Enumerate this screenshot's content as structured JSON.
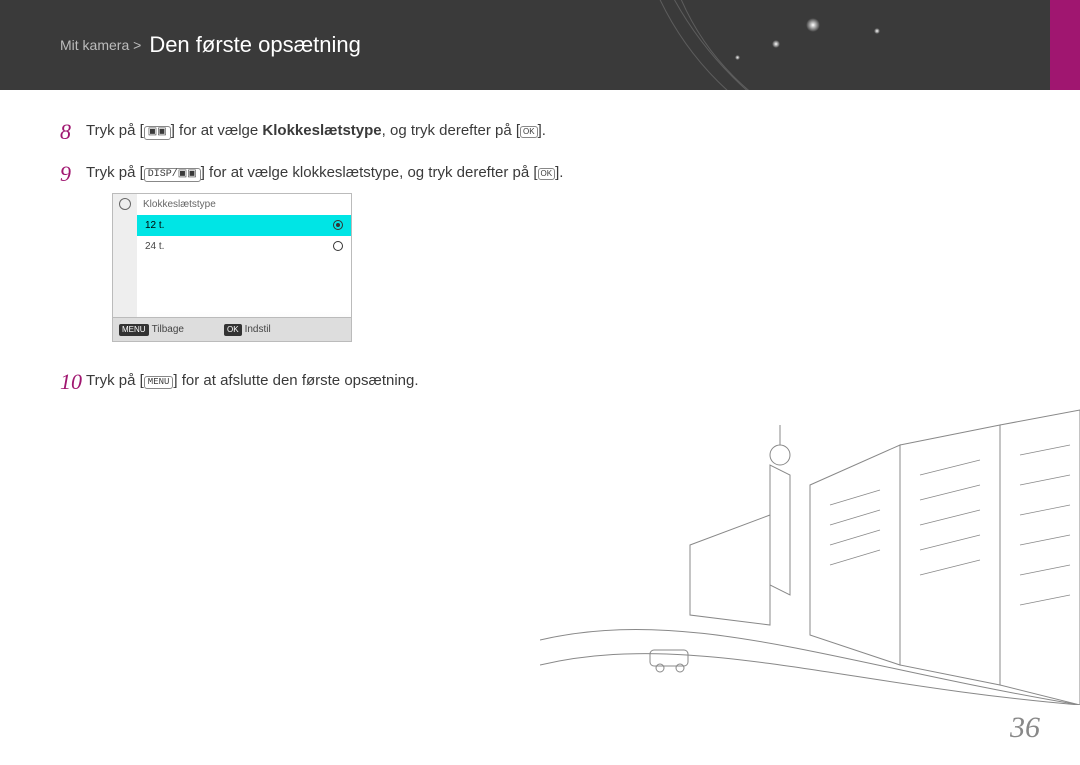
{
  "header": {
    "breadcrumb": "Mit kamera >",
    "title": "Den første opsætning"
  },
  "steps": {
    "s8": {
      "num": "8",
      "t1": "Tryk på [",
      "btn1": "▣▣",
      "t2": "] for at vælge ",
      "bold": "Klokkeslætstype",
      "t3": ", og tryk derefter på [",
      "ok": "OK",
      "t4": "]."
    },
    "s9": {
      "num": "9",
      "t1": "Tryk på [",
      "btn1": "DISP/▣▣",
      "t2": "] for at vælge klokkeslætstype, og tryk derefter på [",
      "ok": "OK",
      "t3": "]."
    },
    "s10": {
      "num": "10",
      "t1": "Tryk på [",
      "btn1": "MENU",
      "t2": "] for at afslutte den første opsætning."
    }
  },
  "uiBox": {
    "title": "Klokkeslætstype",
    "option1": "12 t.",
    "option2": "24 t.",
    "footer": {
      "back_tag": "MENU",
      "back_label": "Tilbage",
      "set_tag": "OK",
      "set_label": "Indstil"
    }
  },
  "pageNumber": "36"
}
